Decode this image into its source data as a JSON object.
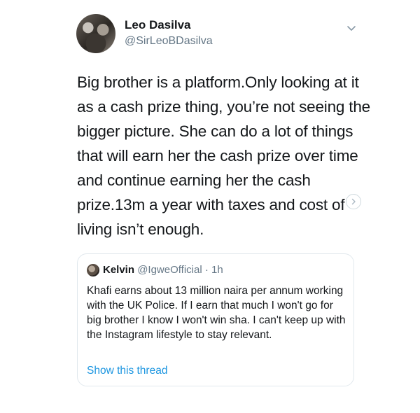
{
  "tweet": {
    "author_name": "Leo Dasilva",
    "author_handle": "@SirLeoBDasilva",
    "text": "Big brother is a platform.Only looking at it as a cash prize thing, you’re not seeing the bigger picture. She can do a lot of things that will earn her the cash prize over time and continue earning her the cash prize.13m a year with taxes and cost of living isn’t enough."
  },
  "quoted_tweet": {
    "author_name": "Kelvin",
    "author_handle": "@IgweOfficial",
    "separator": " · ",
    "time": "1h",
    "text": "Khafi earns about 13 million naira per annum working with the UK Police. If I earn that much I won't go for big brother I know I won't win sha. I can't keep up with the Instagram lifestyle to stay relevant.",
    "show_thread_label": "Show this thread"
  },
  "icons": {
    "menu": "chevron-down-icon",
    "next": "chevron-right-icon"
  },
  "colors": {
    "link": "#1b95e0",
    "secondary_text": "#657786",
    "border": "#e1e8ed"
  }
}
